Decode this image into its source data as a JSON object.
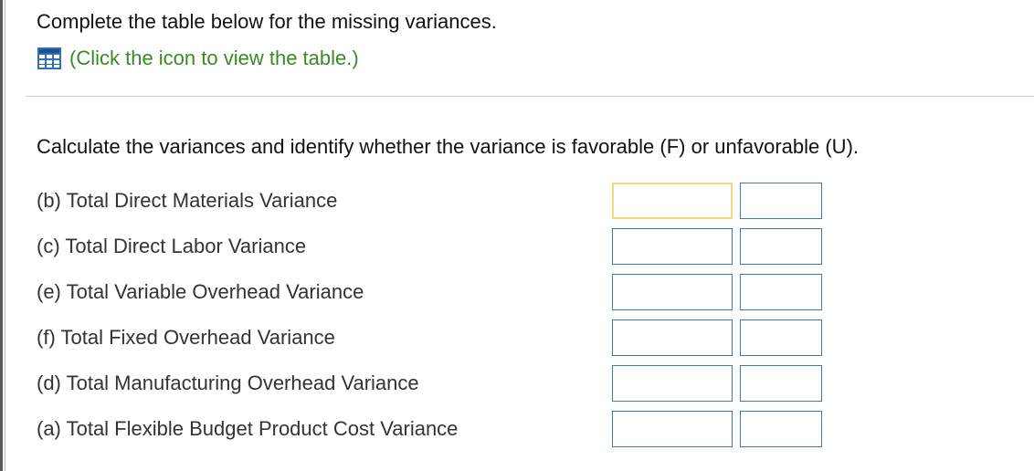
{
  "instruction": "Complete the table below for the missing variances.",
  "table_link": {
    "icon": "table-icon",
    "label": "(Click the icon to view the table.)"
  },
  "question": "Calculate the variances and identify whether the variance is favorable (F) or unfavorable (U).",
  "rows": [
    {
      "label": "(b) Total Direct Materials Variance",
      "amount": "",
      "fu": ""
    },
    {
      "label": "(c) Total Direct Labor Variance",
      "amount": "",
      "fu": ""
    },
    {
      "label": "(e) Total Variable Overhead Variance",
      "amount": "",
      "fu": ""
    },
    {
      "label": "(f) Total Fixed Overhead Variance",
      "amount": "",
      "fu": ""
    },
    {
      "label": "(d) Total Manufacturing Overhead Variance",
      "amount": "",
      "fu": ""
    },
    {
      "label": "(a) Total Flexible Budget Product Cost Variance",
      "amount": "",
      "fu": ""
    }
  ],
  "colors": {
    "link": "#3a8a23",
    "input_border": "#3f79a8",
    "focus_border": "#f6d77a",
    "icon_blue": "#2f6fb5"
  }
}
